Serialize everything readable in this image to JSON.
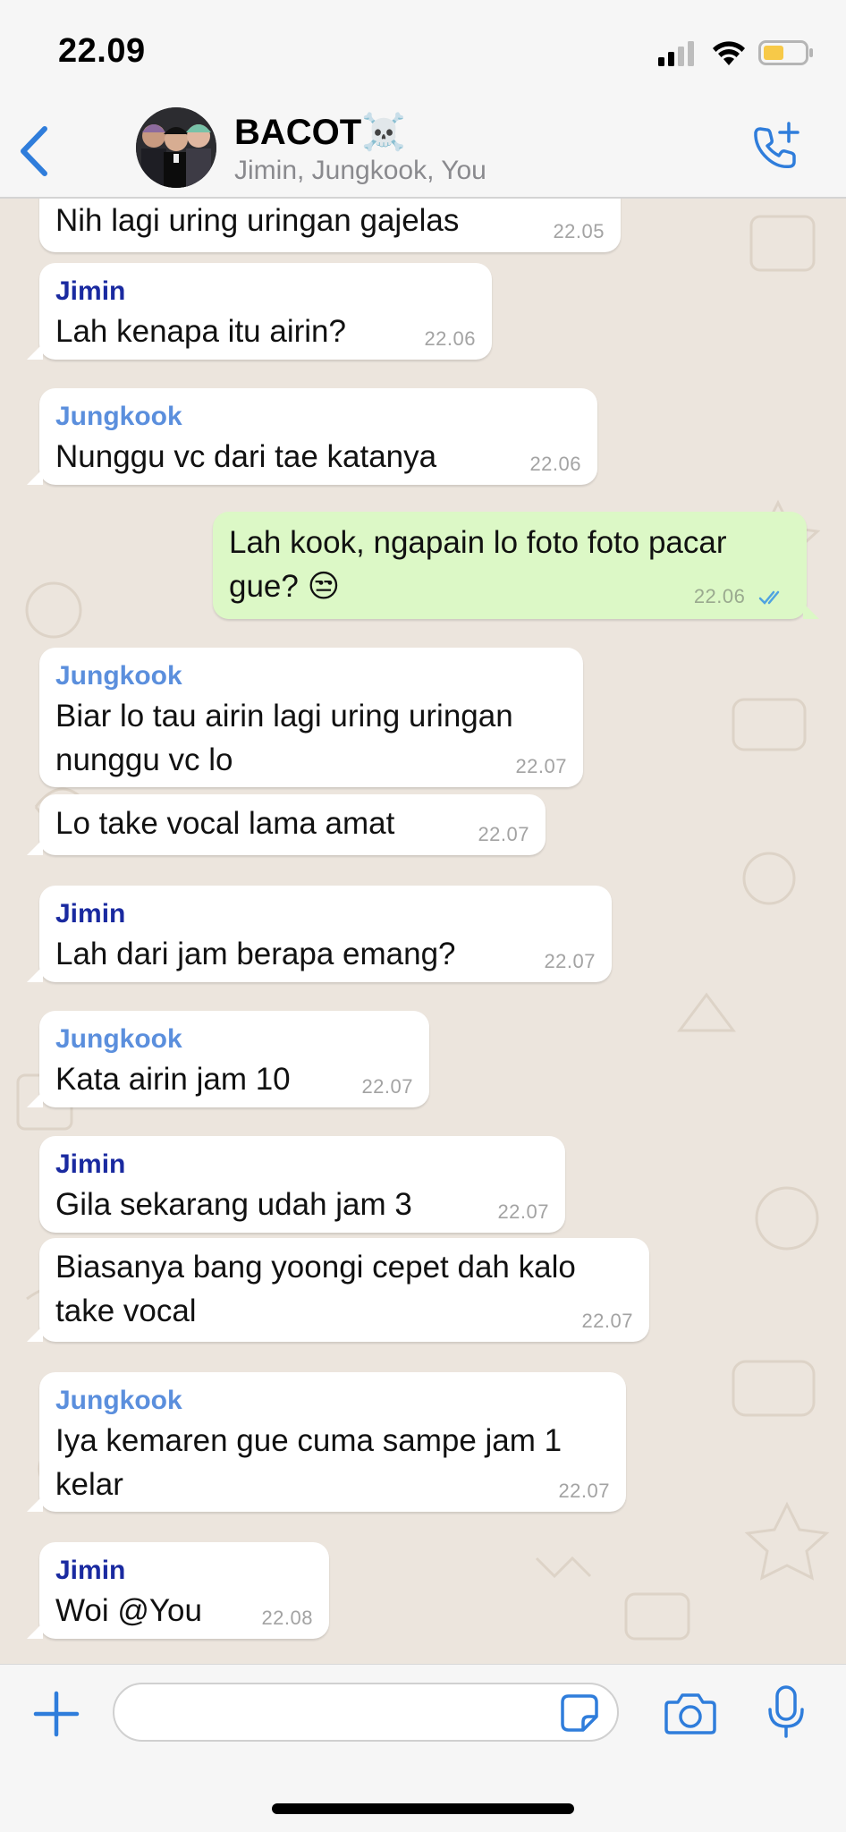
{
  "status_bar": {
    "time": "22.09",
    "battery_color": "#f7c948"
  },
  "header": {
    "title": "BACOT☠️",
    "subtitle": "Jimin, Jungkook, You",
    "accent": "#2f7ddb"
  },
  "messages": [
    {
      "sender": "",
      "text": "Nih lagi uring uringan gajelas",
      "time": "22.05"
    },
    {
      "sender": "Jimin",
      "text": "Lah kenapa itu airin?",
      "time": "22.06"
    },
    {
      "sender": "Jungkook",
      "text": "Nunggu vc dari tae katanya",
      "time": "22.06"
    },
    {
      "sender": "You",
      "text": "Lah kook, ngapain lo foto foto pacar gue? 😒",
      "time": "22.06",
      "status": "read"
    },
    {
      "sender": "Jungkook",
      "text": "Biar lo tau airin lagi uring uringan nunggu vc lo",
      "time": "22.07"
    },
    {
      "sender": "",
      "text": "Lo take vocal lama amat",
      "time": "22.07"
    },
    {
      "sender": "Jimin",
      "text": "Lah dari jam berapa emang?",
      "time": "22.07"
    },
    {
      "sender": "Jungkook",
      "text": "Kata airin jam 10",
      "time": "22.07"
    },
    {
      "sender": "Jimin",
      "text": "Gila sekarang udah jam 3",
      "time": "22.07"
    },
    {
      "sender": "",
      "text": "Biasanya bang yoongi cepet dah kalo take vocal",
      "time": "22.07"
    },
    {
      "sender": "Jungkook",
      "text": "Iya kemaren gue cuma sampe jam 1 kelar",
      "time": "22.07"
    },
    {
      "sender": "Jimin",
      "text": "Woi @You",
      "time": "22.08"
    }
  ],
  "input": {
    "placeholder": "",
    "value": ""
  },
  "colors": {
    "jimin": "#1a2aa0",
    "jungkook": "#5b8fdd",
    "outgoing_bubble": "#dcf8c6",
    "chat_background": "#ece5dd"
  }
}
